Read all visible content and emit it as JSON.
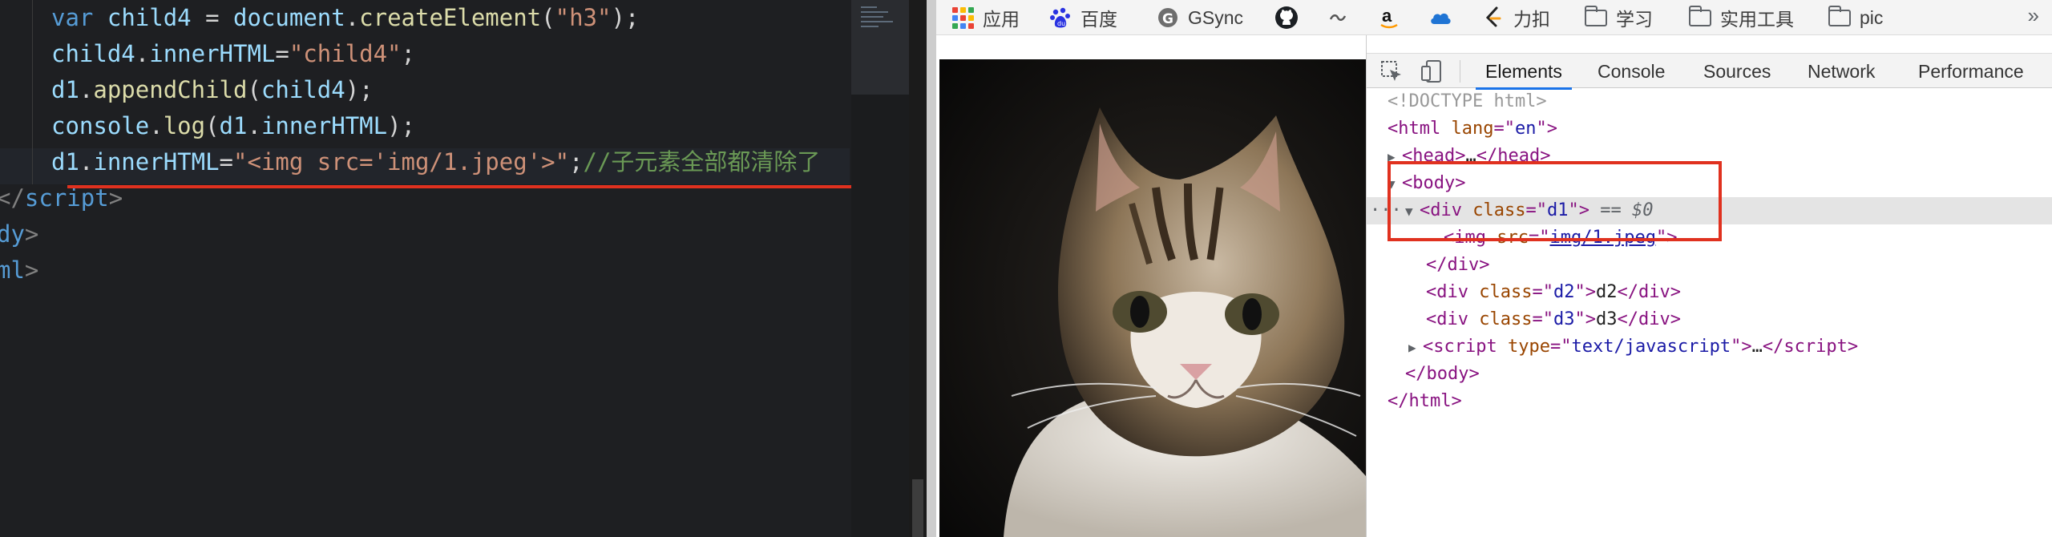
{
  "editor": {
    "lines": [
      {
        "indent": "    ",
        "parts": [
          [
            "kw",
            "var"
          ],
          [
            "plain",
            " "
          ],
          [
            "var",
            "child4"
          ],
          [
            "plain",
            " = "
          ],
          [
            "var",
            "document"
          ],
          [
            "plain",
            "."
          ],
          [
            "fn",
            "createElement"
          ],
          [
            "plain",
            "("
          ],
          [
            "str",
            "\"h3\""
          ],
          [
            "plain",
            ");"
          ]
        ]
      },
      {
        "indent": "    ",
        "parts": [
          [
            "var",
            "child4"
          ],
          [
            "plain",
            "."
          ],
          [
            "var",
            "innerHTML"
          ],
          [
            "plain",
            "="
          ],
          [
            "str",
            "\"child4\""
          ],
          [
            "plain",
            ";"
          ]
        ]
      },
      {
        "indent": "    ",
        "parts": [
          [
            "var",
            "d1"
          ],
          [
            "plain",
            "."
          ],
          [
            "fn",
            "appendChild"
          ],
          [
            "plain",
            "("
          ],
          [
            "var",
            "child4"
          ],
          [
            "plain",
            ");"
          ]
        ]
      },
      {
        "indent": "    ",
        "parts": [
          [
            "var",
            "console"
          ],
          [
            "plain",
            "."
          ],
          [
            "fn",
            "log"
          ],
          [
            "plain",
            "("
          ],
          [
            "var",
            "d1"
          ],
          [
            "plain",
            "."
          ],
          [
            "var",
            "innerHTML"
          ],
          [
            "plain",
            ");"
          ]
        ]
      },
      {
        "indent": "    ",
        "parts": [
          [
            "var",
            "d1"
          ],
          [
            "plain",
            "."
          ],
          [
            "var",
            "innerHTML"
          ],
          [
            "plain",
            "="
          ],
          [
            "str",
            "\"<img src='img/1.jpeg'>\""
          ],
          [
            "plain",
            ";"
          ],
          [
            "cmt",
            "//子元素全部都清除了"
          ]
        ]
      },
      {
        "indent": "",
        "parts": [
          [
            "pun",
            "</"
          ],
          [
            "tag",
            "script"
          ],
          [
            "pun",
            ">"
          ]
        ]
      },
      {
        "indent": "",
        "parts": [
          [
            "tag",
            "dy"
          ],
          [
            "pun",
            ">"
          ]
        ]
      },
      {
        "indent": "",
        "parts": [
          [
            "tag",
            "ml"
          ],
          [
            "pun",
            ">"
          ]
        ]
      }
    ]
  },
  "bookmarks": {
    "items": [
      {
        "label": "应用",
        "icon": "apps-grid-icon"
      },
      {
        "label": "百度",
        "icon": "baidu-icon"
      },
      {
        "label": "GSync",
        "icon": "gsync-icon"
      },
      {
        "label": "",
        "icon": "github-icon"
      },
      {
        "label": "",
        "icon": "squiggle-icon"
      },
      {
        "label": "",
        "icon": "amazon-icon"
      },
      {
        "label": "",
        "icon": "cloud-icon"
      },
      {
        "label": "力扣",
        "icon": "leetcode-icon"
      },
      {
        "label": "学习",
        "icon": "folder-icon"
      },
      {
        "label": "实用工具",
        "icon": "folder-icon"
      },
      {
        "label": "pic",
        "icon": "folder-icon"
      }
    ],
    "more": "»"
  },
  "devtools": {
    "tabs": [
      "Elements",
      "Console",
      "Sources",
      "Network",
      "Performance"
    ],
    "active_tab": "Elements",
    "dom": {
      "doctype": "<!DOCTYPE html>",
      "html_open": {
        "tag": "html",
        "attr": "lang",
        "val": "en"
      },
      "head": {
        "tag": "head",
        "ellipsis": "…"
      },
      "body_open": "body",
      "div_d1": {
        "tag": "div",
        "attr": "class",
        "val": "d1",
        "marker": "== $0"
      },
      "img": {
        "tag": "img",
        "attr": "src",
        "val": "img/1.jpeg"
      },
      "div_close": "div",
      "div_d2": {
        "tag": "div",
        "attr": "class",
        "val": "d2",
        "text": "d2"
      },
      "div_d3": {
        "tag": "div",
        "attr": "class",
        "val": "d3",
        "text": "d3"
      },
      "script": {
        "tag": "script",
        "attr": "type",
        "val": "text/javascript",
        "ellipsis": "…"
      },
      "body_close": "body",
      "html_close": "html",
      "dots": "···"
    }
  },
  "colors": {
    "accent_red": "#e0311f",
    "devtools_tab_underline": "#1a73e8"
  }
}
